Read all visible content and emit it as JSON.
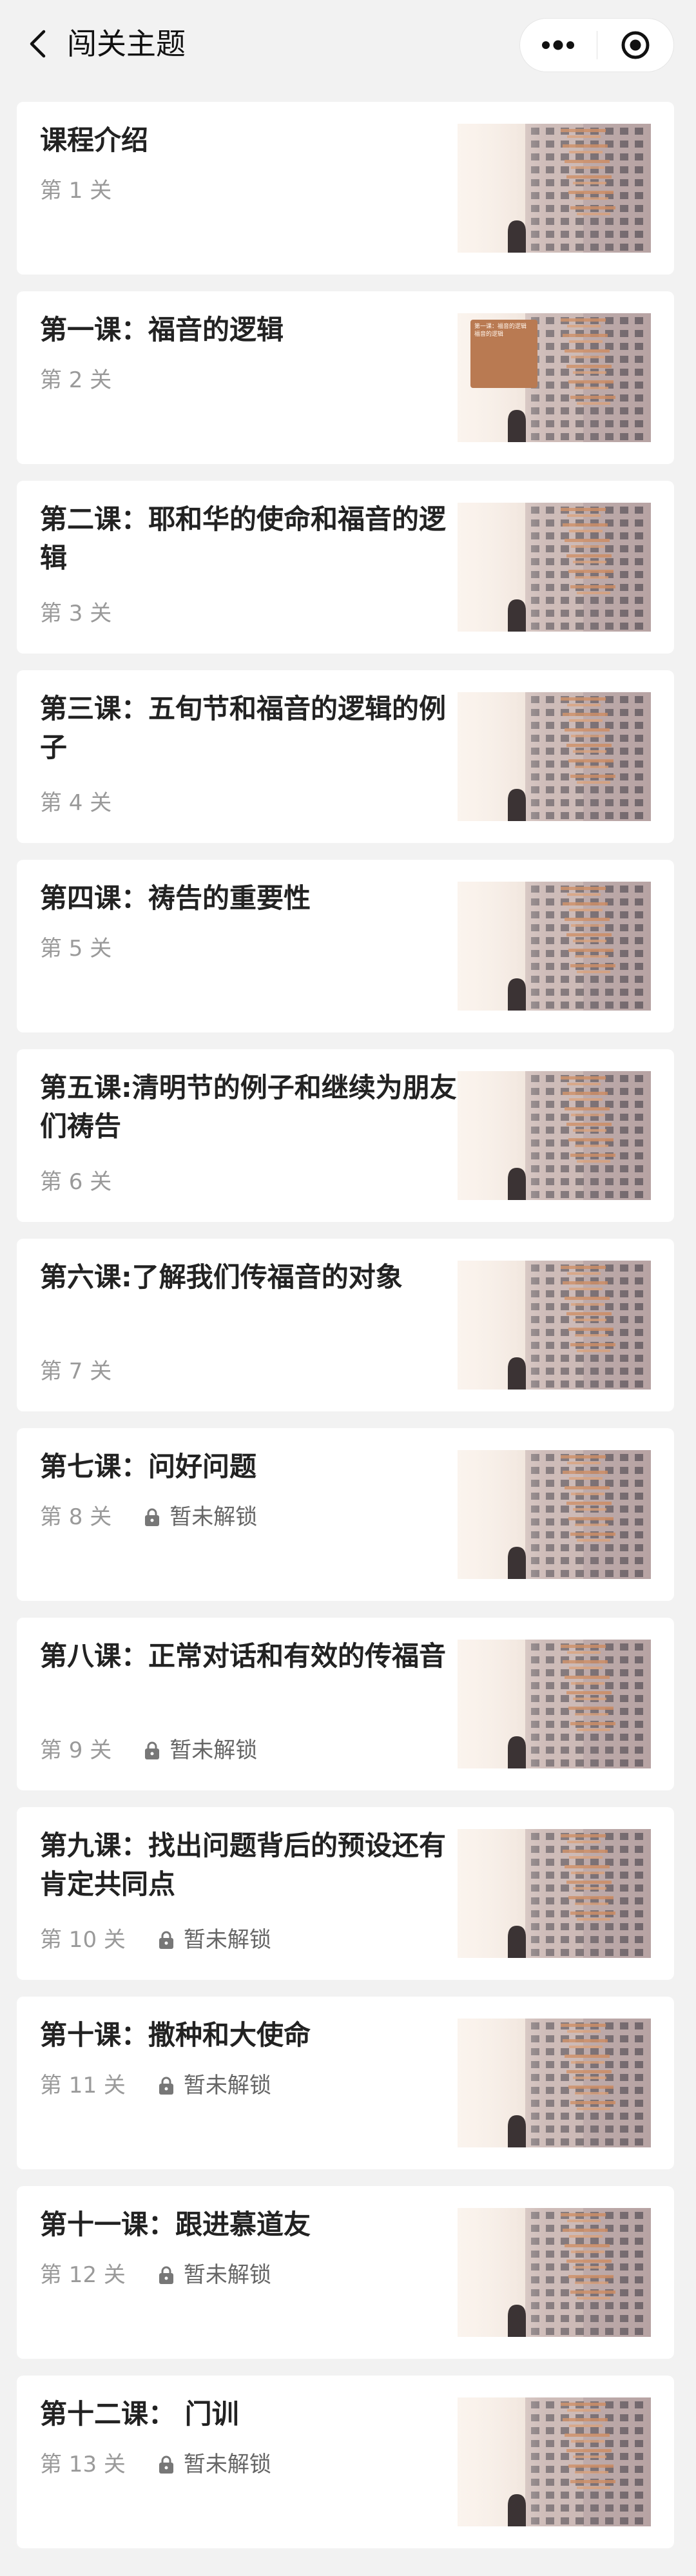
{
  "nav": {
    "title": "闯关主题"
  },
  "lock_text": "暂未解锁",
  "lessons": [
    {
      "title": "课程介绍",
      "level": "第 1 关",
      "locked": false
    },
    {
      "title": "第一课：福音的逻辑",
      "level": "第 2 关",
      "locked": false,
      "thumb_sign": {
        "head": "第一课：福音的逻辑",
        "body": "福音的逻辑"
      }
    },
    {
      "title": "第二课：耶和华的使命和福音的逻辑",
      "level": "第 3 关",
      "locked": false
    },
    {
      "title": "第三课：五旬节和福音的逻辑的例子",
      "level": "第 4 关",
      "locked": false
    },
    {
      "title": "第四课：祷告的重要性",
      "level": "第 5 关",
      "locked": false
    },
    {
      "title": "第五课:清明节的例子和继续为朋友们祷告",
      "level": "第 6 关",
      "locked": false
    },
    {
      "title": "第六课:了解我们传福音的对象",
      "level": "第 7 关",
      "locked": false
    },
    {
      "title": "第七课：问好问题",
      "level": "第 8 关",
      "locked": true
    },
    {
      "title": "第八课：正常对话和有效的传福音",
      "level": "第 9 关",
      "locked": true
    },
    {
      "title": "第九课：找出问题背后的预设还有肯定共同点",
      "level": "第 10 关",
      "locked": true
    },
    {
      "title": "第十课：撒种和大使命",
      "level": "第 11 关",
      "locked": true
    },
    {
      "title": "第十一课：跟进慕道友",
      "level": "第 12 关",
      "locked": true
    },
    {
      "title": "第十二课： 门训",
      "level": "第 13 关",
      "locked": true
    }
  ]
}
